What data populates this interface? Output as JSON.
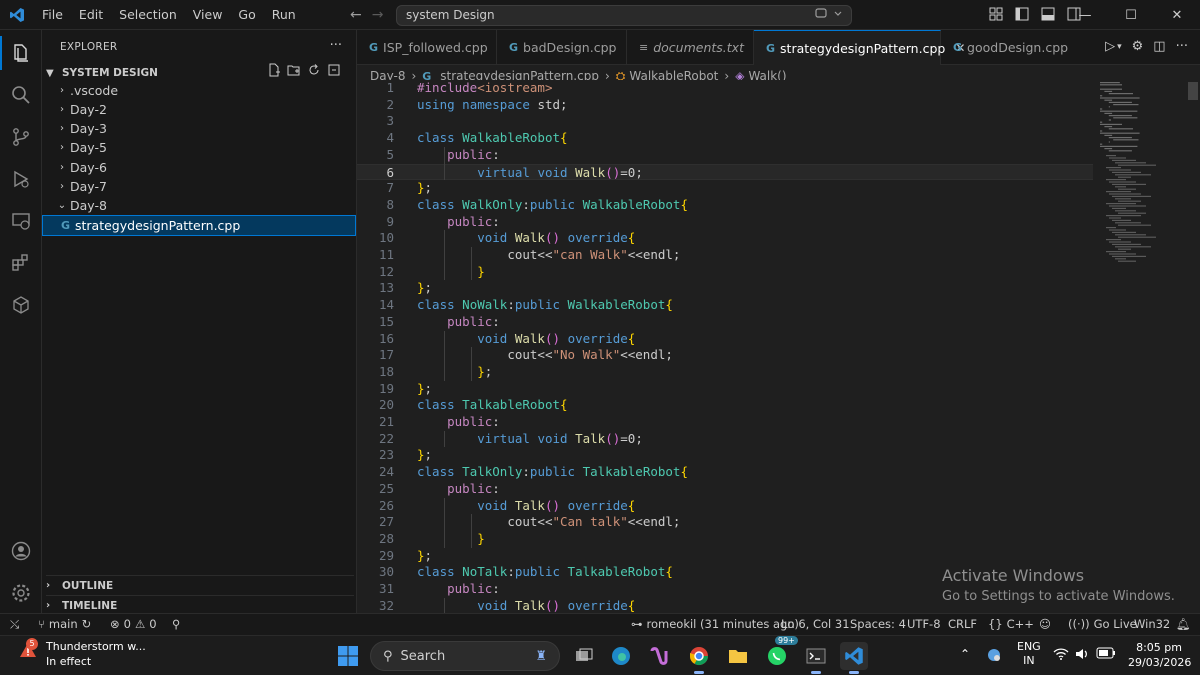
{
  "titlebar": {
    "menu": [
      "File",
      "Edit",
      "Selection",
      "View",
      "Go",
      "Run"
    ],
    "search_text": "system Design"
  },
  "sidebar": {
    "title": "EXPLORER",
    "folder": "SYSTEM DESIGN",
    "items": [
      {
        "label": ".vscode"
      },
      {
        "label": "Day-2"
      },
      {
        "label": "Day-3"
      },
      {
        "label": "Day-5"
      },
      {
        "label": "Day-6"
      },
      {
        "label": "Day-7"
      },
      {
        "label": "Day-8"
      },
      {
        "label": "strategydesignPattern.cpp"
      }
    ],
    "outline": "OUTLINE",
    "timeline": "TIMELINE"
  },
  "tabs": [
    {
      "label": "ISP_followed.cpp"
    },
    {
      "label": "badDesign.cpp"
    },
    {
      "label": "documents.txt"
    },
    {
      "label": "strategydesignPattern.cpp"
    },
    {
      "label": "goodDesign.cpp"
    }
  ],
  "breadcrumb": {
    "folder": "Day-8",
    "file": "strategydesignPattern.cpp",
    "cls": "WalkableRobot",
    "method": "Walk()"
  },
  "code_lines": [
    {
      "n": "1",
      "t": "#include<iostream>"
    },
    {
      "n": "2",
      "t": "using namespace std;"
    },
    {
      "n": "3",
      "t": ""
    },
    {
      "n": "4",
      "t": "class WalkableRobot{"
    },
    {
      "n": "5",
      "t": "    public:"
    },
    {
      "n": "6",
      "t": "        virtual void Walk()=0;"
    },
    {
      "n": "7",
      "t": "};"
    },
    {
      "n": "8",
      "t": "class WalkOnly:public WalkableRobot{"
    },
    {
      "n": "9",
      "t": "    public:"
    },
    {
      "n": "10",
      "t": "        void Walk() override{"
    },
    {
      "n": "11",
      "t": "            cout<<\"can Walk\"<<endl;"
    },
    {
      "n": "12",
      "t": "        }"
    },
    {
      "n": "13",
      "t": "};"
    },
    {
      "n": "14",
      "t": "class NoWalk:public WalkableRobot{"
    },
    {
      "n": "15",
      "t": "    public:"
    },
    {
      "n": "16",
      "t": "        void Walk() override{"
    },
    {
      "n": "17",
      "t": "            cout<<\"No Walk\"<<endl;"
    },
    {
      "n": "18",
      "t": "        };"
    },
    {
      "n": "19",
      "t": "};"
    },
    {
      "n": "20",
      "t": "class TalkableRobot{"
    },
    {
      "n": "21",
      "t": "    public:"
    },
    {
      "n": "22",
      "t": "        virtual void Talk()=0;"
    },
    {
      "n": "23",
      "t": "};"
    },
    {
      "n": "24",
      "t": "class TalkOnly:public TalkableRobot{"
    },
    {
      "n": "25",
      "t": "    public:"
    },
    {
      "n": "26",
      "t": "        void Talk() override{"
    },
    {
      "n": "27",
      "t": "            cout<<\"Can talk\"<<endl;"
    },
    {
      "n": "28",
      "t": "        }"
    },
    {
      "n": "29",
      "t": "};"
    },
    {
      "n": "30",
      "t": "class NoTalk:public TalkableRobot{"
    },
    {
      "n": "31",
      "t": "    public:"
    },
    {
      "n": "32",
      "t": "        void Talk() override{"
    }
  ],
  "watermark": {
    "title": "Activate Windows",
    "subtitle": "Go to Settings to activate Windows."
  },
  "statusbar": {
    "branch": "main",
    "errors": "0",
    "warnings": "0",
    "blame": "romeokil (31 minutes ago)",
    "cursor": "Ln 6, Col 31",
    "spaces": "Spaces: 4",
    "encoding": "UTF-8",
    "eol": "CRLF",
    "language": "C++",
    "golive": "Go Live",
    "platform": "Win32"
  },
  "taskbar": {
    "weather_title": "Thunderstorm w...",
    "weather_sub": "In effect",
    "weather_badge": "5",
    "search": "Search",
    "whatsapp_badge": "99+",
    "lang1": "ENG",
    "lang2": "IN",
    "time": "8:05 pm",
    "date": "29/03/2026"
  },
  "colors": {
    "keyword": "#c586c0",
    "type": "#569cd6",
    "class": "#4ec9b0",
    "func": "#dcdcaa",
    "string": "#ce9178",
    "accent": "#0078d4"
  }
}
